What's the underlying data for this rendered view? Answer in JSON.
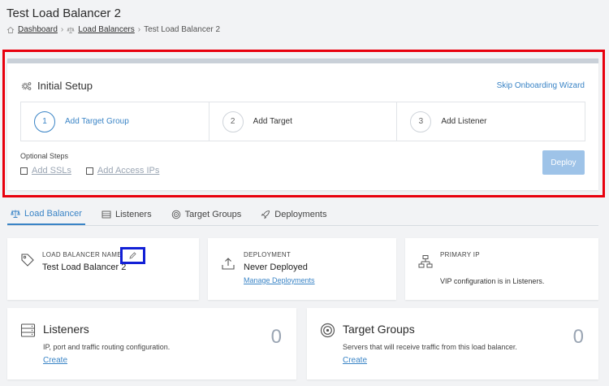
{
  "page": {
    "title": "Test Load Balancer 2",
    "breadcrumb": [
      "Dashboard",
      "Load Balancers",
      "Test Load Balancer 2"
    ]
  },
  "setup": {
    "title": "Initial Setup",
    "skip_label": "Skip Onboarding Wizard",
    "steps": [
      {
        "num": "1",
        "label": "Add Target Group",
        "active": true
      },
      {
        "num": "2",
        "label": "Add Target",
        "active": false
      },
      {
        "num": "3",
        "label": "Add Listener",
        "active": false
      }
    ],
    "optional_title": "Optional Steps",
    "optional": [
      "Add SSLs",
      "Add Access IPs"
    ],
    "deploy_label": "Deploy"
  },
  "tabs": [
    "Load Balancer",
    "Listeners",
    "Target Groups",
    "Deployments"
  ],
  "info": {
    "name_label": "LOAD BALANCER NAME",
    "name_value": "Test Load Balancer 2",
    "deployment_label": "DEPLOYMENT",
    "deployment_value": "Never Deployed",
    "deployment_link": "Manage Deployments",
    "ip_label": "PRIMARY IP",
    "ip_note": "VIP configuration is in Listeners."
  },
  "summary": {
    "listeners": {
      "title": "Listeners",
      "desc": "IP, port and traffic routing configuration.",
      "link": "Create",
      "count": "0"
    },
    "target_groups": {
      "title": "Target Groups",
      "desc": "Servers that will receive traffic from this load balancer.",
      "link": "Create",
      "count": "0"
    }
  },
  "colors": {
    "accent": "#3a84c6",
    "highlight_red": "#e8000d",
    "highlight_blue": "#1220d6"
  }
}
